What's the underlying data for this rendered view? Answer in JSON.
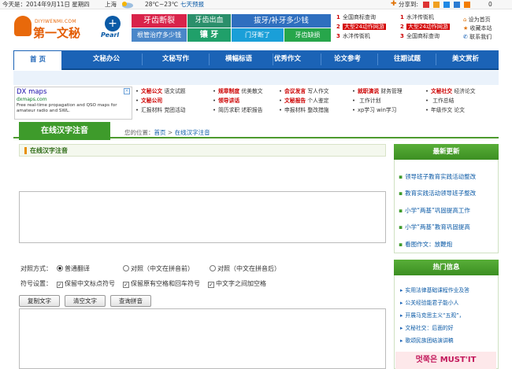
{
  "topbar": {
    "date": "今天是：2014年9月11日 星期四",
    "city": "上海",
    "weather": "28℃~23℃",
    "forecast": "七天预报",
    "share": "分享到:",
    "share_count": "0"
  },
  "logo": {
    "en": "DIYIWENMI.COM",
    "cn": "第一文秘"
  },
  "pearl": {
    "text": "Pearl"
  },
  "ads": {
    "a1": "牙齿断裂",
    "a2": "牙齿出血",
    "a3": "拔牙/补牙多少钱",
    "a4": "根管治疗多少钱",
    "a5": "镶 牙",
    "a6": "门牙断了",
    "a7": "牙齿缺损"
  },
  "ranklinks": [
    {
      "n": "1",
      "t": "全国商标查询",
      "hl": false
    },
    {
      "n": "2",
      "t": "大型24动作网游",
      "hl": true
    },
    {
      "n": "3",
      "t": "水泮传街机",
      "hl": false
    },
    {
      "n": "1",
      "t": "水泮传街机",
      "hl": false
    },
    {
      "n": "2",
      "t": "大型24动作网游",
      "hl": true
    },
    {
      "n": "3",
      "t": "全国商标查询",
      "hl": false
    }
  ],
  "util": {
    "home": "设为首页",
    "fav": "收藏本站",
    "contact": "联系我们"
  },
  "nav": [
    "首 页",
    "文秘办公",
    "文秘写作",
    "横幅标语",
    "优秀作文",
    "论文参考",
    "往期试题",
    "美文赏析"
  ],
  "dxad": {
    "title": "DX maps",
    "url": "dxmaps.com",
    "desc": "Free real-time propagation and QSO maps for amateur radio and SWL."
  },
  "links": [
    [
      "文秘公文",
      "语文试题",
      "规章制度",
      "优美散文",
      "会议发言",
      "写人作文",
      "就职演说",
      "财务管理",
      "文秘社交",
      "经济论文"
    ],
    [
      "文秘公司",
      "",
      "领导讲话",
      "",
      "文秘报告",
      "个人鉴定",
      "",
      "工作计划",
      "",
      "工作总结"
    ],
    [
      "汇报材料",
      "党团活动",
      "简历求职",
      "述职报告",
      "申报材料",
      "整改措施",
      "xp学习",
      "win学习",
      "年级作文",
      "论文"
    ]
  ],
  "page_title": "在线汉字注音",
  "crumb": {
    "label": "您的位置：",
    "home": "首页",
    "sep": ">",
    "current": "在线汉字注音"
  },
  "main_heading": "在线汉字注音",
  "options": {
    "mode_label": "对照方式：",
    "m1": "普通翻译",
    "m2": "对照（中文在拼音前）",
    "m3": "对照（中文在拼音后）",
    "sym_label": "符号设置：",
    "c1": "保留中文标点符号",
    "c2": "保留原有空格和回车符号",
    "c3": "中文字之间加空格"
  },
  "buttons": {
    "copy": "复制文字",
    "clear": "清空文字",
    "query": "查询拼音"
  },
  "sidebar": {
    "latest": "最新更新",
    "latest_items": [
      "领导班子教育实践活动整改",
      "教育实践活动领导班子整改",
      "小学“两基”巩固提高工作",
      "小学“两基”教育巩固提高",
      "看图作文：放鞭炮"
    ],
    "hot": "热门信息",
    "hot_items": [
      "实用法律基础课程作业及答",
      "公关经验能君子能小人",
      "开展马克思主义“五观”，",
      "文秘社交：后面的好",
      "歌颂民族团结演讲稿"
    ],
    "ad_text": "멋쭉은 MUST'IT"
  }
}
